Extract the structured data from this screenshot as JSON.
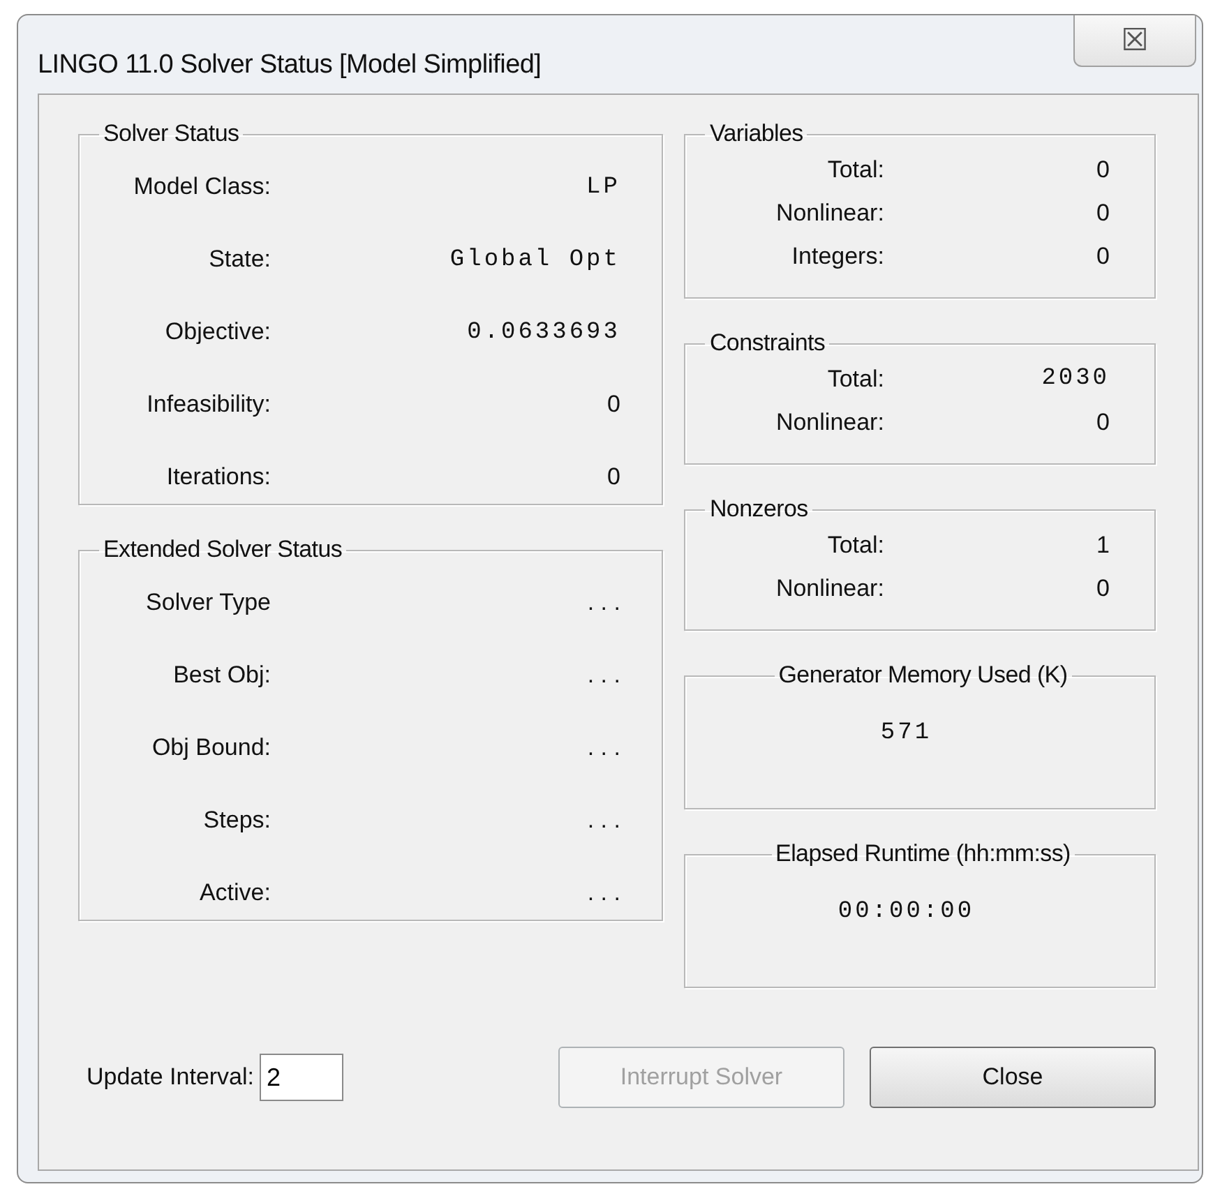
{
  "window": {
    "title": "LINGO 11.0 Solver Status [Model Simplified]",
    "close_glyph": "☒"
  },
  "left_groups": [
    {
      "title": "Solver Status",
      "kind": "rows",
      "rows": [
        {
          "label": "Model Class:",
          "value": "LP",
          "kind": "mono"
        },
        {
          "label": "State:",
          "value": "Global Opt",
          "kind": "mono"
        },
        {
          "label": "Objective:",
          "value": "0.0633693",
          "kind": "mono"
        },
        {
          "label": "Infeasibility:",
          "value": "0",
          "kind": "plain"
        },
        {
          "label": "Iterations:",
          "value": "0",
          "kind": "plain"
        }
      ]
    },
    {
      "title": "Extended Solver Status",
      "kind": "rows",
      "rows": [
        {
          "label": "Solver Type",
          "value": ". . .",
          "kind": "plain"
        },
        {
          "label": "Best Obj:",
          "value": ". . .",
          "kind": "plain"
        },
        {
          "label": "Obj Bound:",
          "value": ". . .",
          "kind": "plain"
        },
        {
          "label": "Steps:",
          "value": ". . .",
          "kind": "plain"
        },
        {
          "label": "Active:",
          "value": ". . .",
          "kind": "plain"
        }
      ]
    }
  ],
  "right_groups": [
    {
      "title": "Variables",
      "kind": "rows",
      "rows": [
        {
          "label": "Total:",
          "value": "0",
          "kind": "plain"
        },
        {
          "label": "Nonlinear:",
          "value": "0",
          "kind": "plain"
        },
        {
          "label": "Integers:",
          "value": "0",
          "kind": "plain"
        }
      ]
    },
    {
      "title": "Constraints",
      "kind": "rows",
      "rows": [
        {
          "label": "Total:",
          "value": "2030",
          "kind": "mono"
        },
        {
          "label": "Nonlinear:",
          "value": "0",
          "kind": "plain"
        }
      ]
    },
    {
      "title": "Nonzeros",
      "kind": "rows",
      "rows": [
        {
          "label": "Total:",
          "value": "1",
          "kind": "plain"
        },
        {
          "label": "Nonlinear:",
          "value": "0",
          "kind": "plain"
        }
      ]
    },
    {
      "title": "Generator Memory Used (K)",
      "kind": "single",
      "value": "571"
    },
    {
      "title": "Elapsed Runtime (hh:mm:ss)",
      "kind": "single",
      "value": "00:00:00"
    }
  ],
  "update_interval": {
    "label": "Update Interval:",
    "value": "2"
  },
  "buttons": [
    {
      "label": "Interrupt Solver",
      "disabled": true
    },
    {
      "label": "Close",
      "disabled": false
    }
  ]
}
